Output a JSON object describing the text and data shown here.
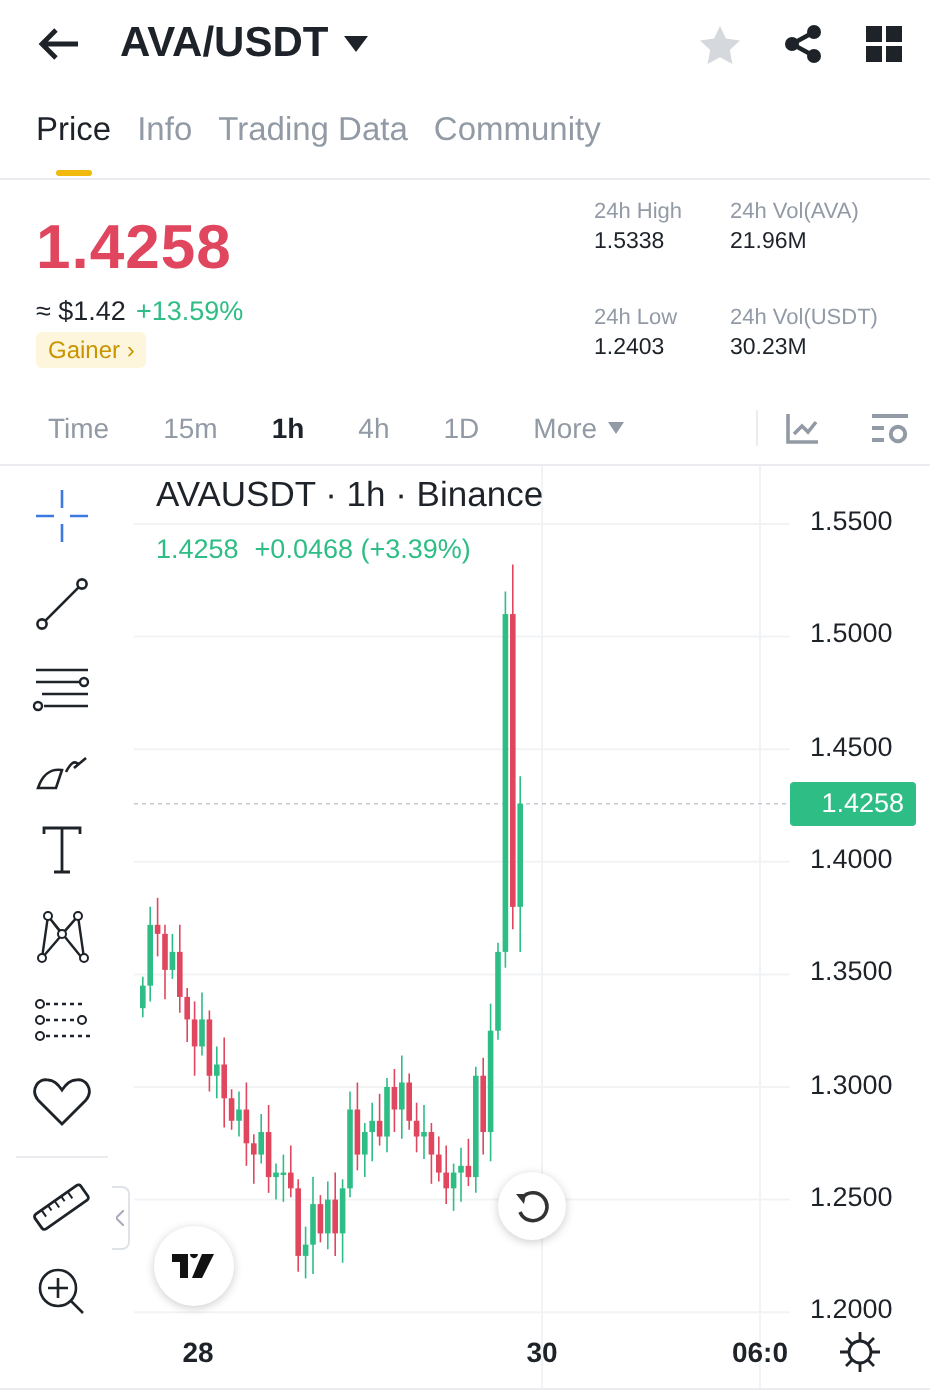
{
  "header": {
    "pair": "AVA/USDT",
    "favorite": false
  },
  "tabs": [
    {
      "label": "Price",
      "selected": true
    },
    {
      "label": "Info",
      "selected": false
    },
    {
      "label": "Trading Data",
      "selected": false
    },
    {
      "label": "Community",
      "selected": false
    }
  ],
  "price": {
    "last": "1.4258",
    "usd": "≈ $1.42",
    "change": "+13.59%",
    "tag": "Gainer",
    "tag_arrow": "›"
  },
  "stats": [
    {
      "label": "24h High",
      "value": "1.5338"
    },
    {
      "label": "24h Vol(AVA)",
      "value": "21.96M"
    },
    {
      "label": "24h Low",
      "value": "1.2403"
    },
    {
      "label": "24h Vol(USDT)",
      "value": "30.23M"
    }
  ],
  "intervals": [
    {
      "label": "Time",
      "kind": "option",
      "selected": false
    },
    {
      "label": "15m",
      "kind": "option",
      "selected": false
    },
    {
      "label": "1h",
      "kind": "option",
      "selected": true
    },
    {
      "label": "4h",
      "kind": "option",
      "selected": false
    },
    {
      "label": "1D",
      "kind": "option",
      "selected": false
    },
    {
      "label": "More",
      "kind": "menu",
      "selected": false
    }
  ],
  "chart": {
    "legend": "AVAUSDT · 1h · Binance",
    "close": "1.4258",
    "change": "+0.0468 (+3.39%)",
    "last_price": "1.4258",
    "y_labels": [
      "1.5500",
      "1.5000",
      "1.4500",
      "1.4000",
      "1.3500",
      "1.3000",
      "1.2500",
      "1.2000"
    ],
    "x_labels": [
      "28",
      "30",
      "06:0"
    ]
  }
}
